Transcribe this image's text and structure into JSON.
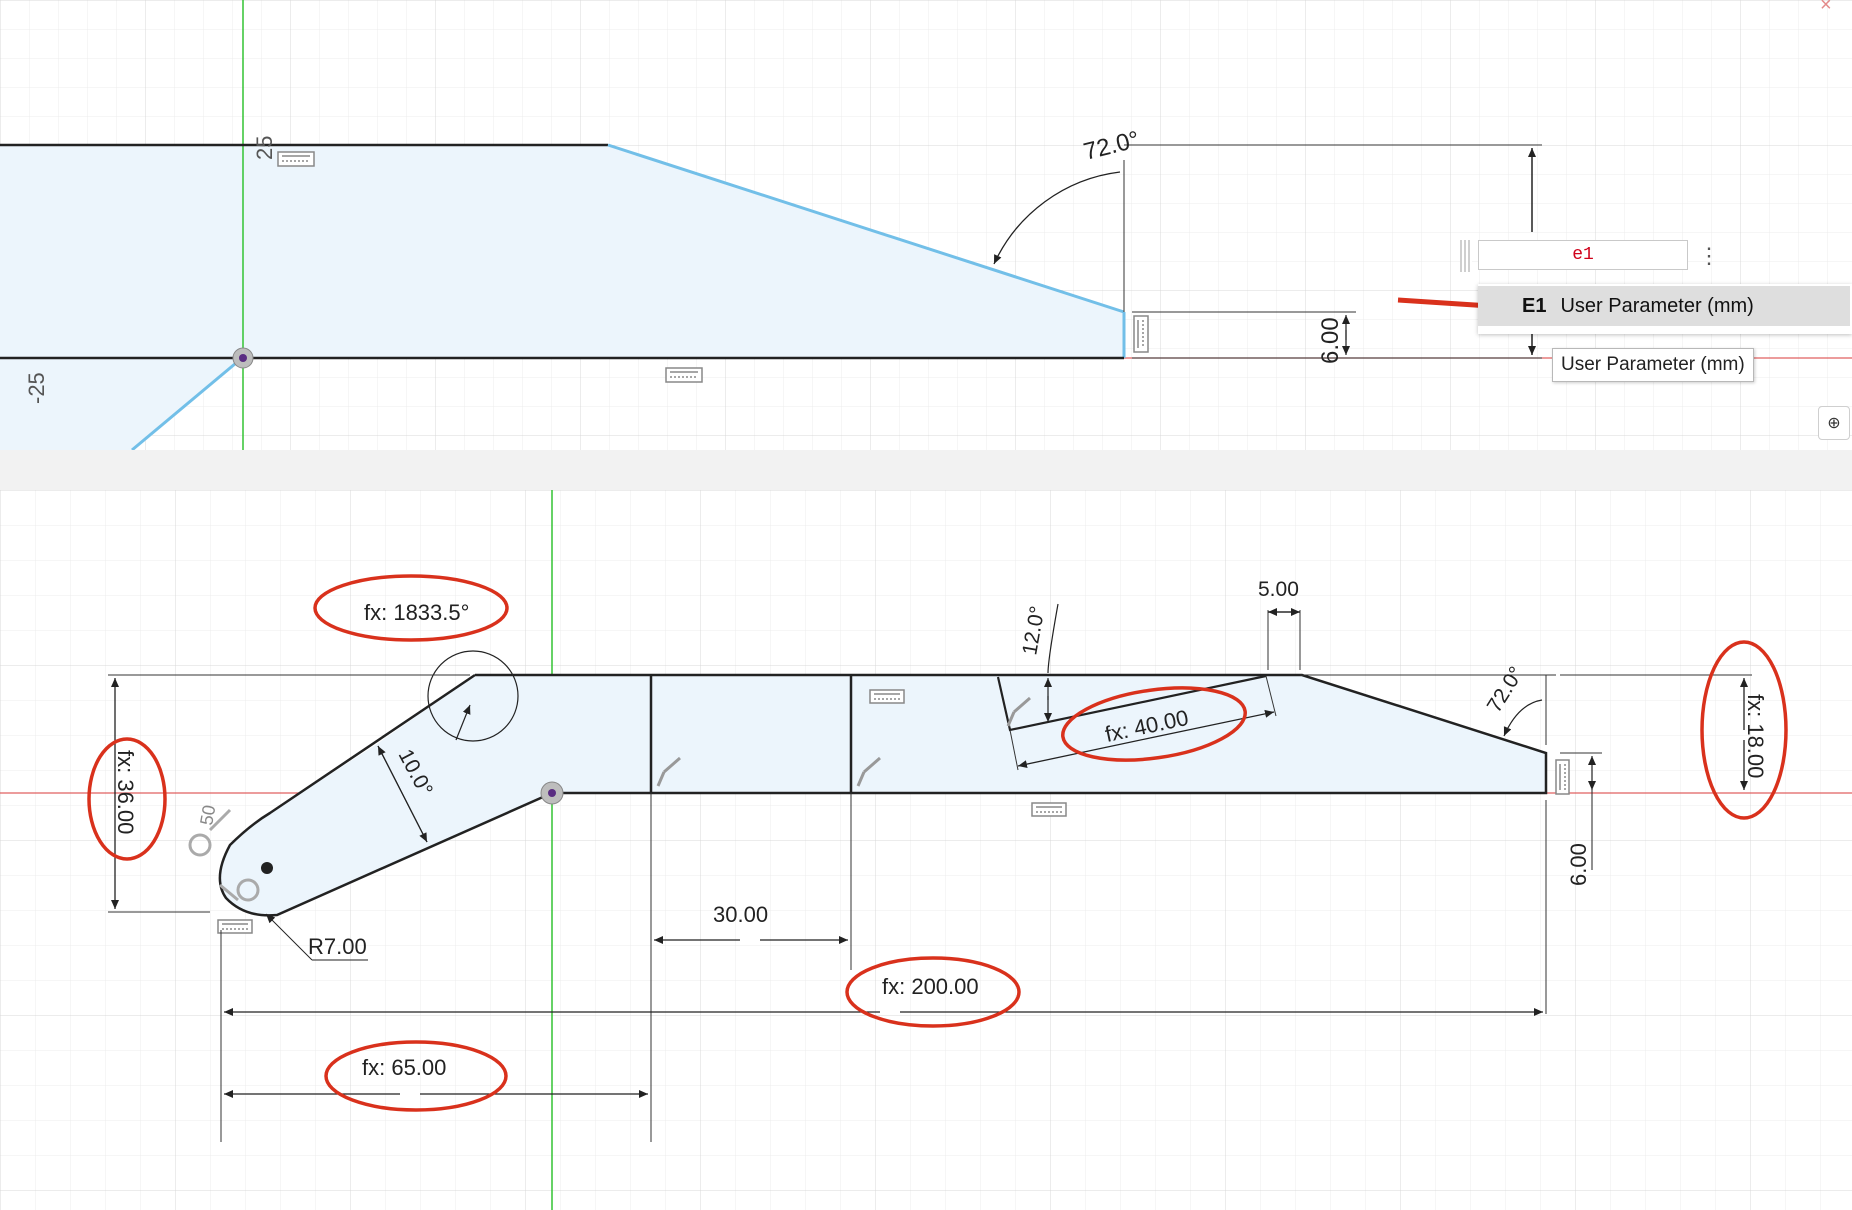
{
  "top_view": {
    "axis_label_x": "25",
    "axis_label_y": "-25",
    "angle_dim": "72.0°",
    "height_dim": "6.00",
    "expression_input": "e1",
    "autocomplete": {
      "key": "E1",
      "label": "User Parameter (mm)"
    },
    "tooltip": "User Parameter (mm)",
    "more_icon": "vertical-dots-icon",
    "plus_icon": "plus-icon",
    "close_icon": "close-icon"
  },
  "bottom_view": {
    "dims": {
      "arc_angle": "fx: 1833.5°",
      "angle_10": "10.0°",
      "overall_height": "fx: 36.00",
      "fillet": "R7.00",
      "width_30": "30.00",
      "width_65": "fx: 65.00",
      "width_200": "fx: 200.00",
      "angle_12": "12.0°",
      "slot_width": "5.00",
      "slot_len": "fx: 40.00",
      "angle_72": "72.0°",
      "right_height": "fx: 18.00",
      "tip_height": "6.00",
      "circle_dim": "50"
    }
  },
  "colors": {
    "highlight": "#d9311c",
    "sketch_fill": "#ecf5fc",
    "selected_line": "#72bfe8",
    "axis_green": "#33c433",
    "axis_red": "#e06060",
    "grid": "#e4e4e4"
  }
}
